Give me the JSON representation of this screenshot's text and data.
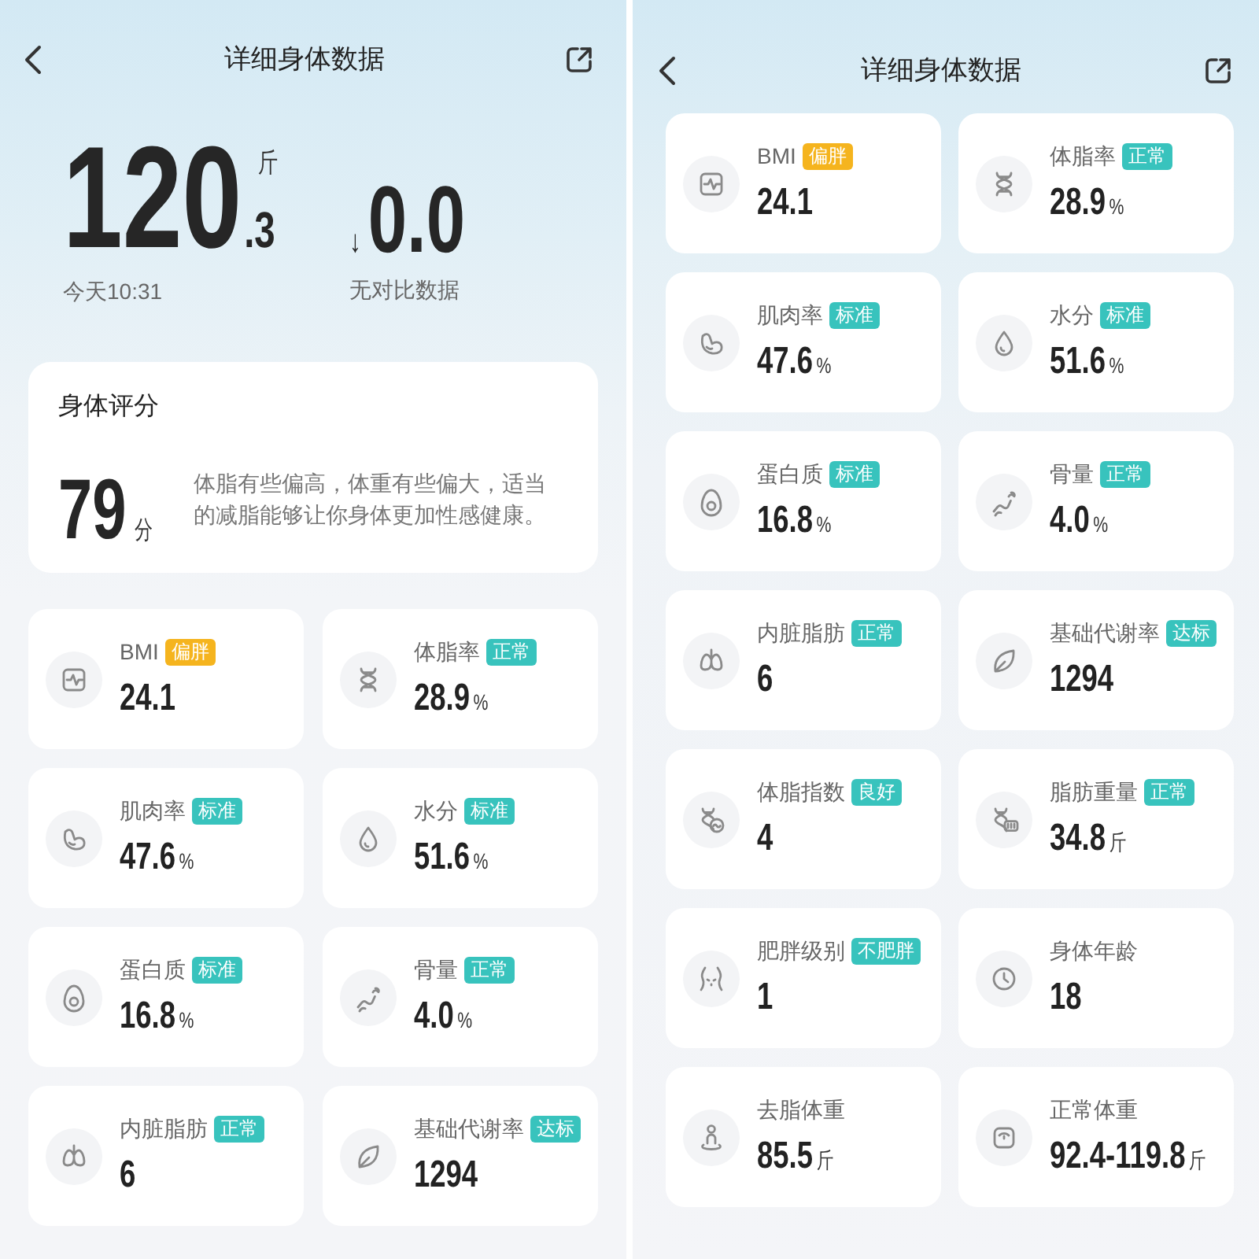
{
  "screens": [
    {
      "header": {
        "title": "详细身体数据"
      },
      "weight": {
        "integer": "120",
        "decimal": ".3",
        "unit": "斤",
        "time": "今天10:31"
      },
      "change": {
        "arrow": "↓",
        "value": "0.0",
        "note": "无对比数据"
      },
      "score_card": {
        "title": "身体评分",
        "score": "79",
        "unit": "分",
        "description": "体脂有些偏高，体重有些偏大，适当的减脂能够让你身体更加性感健康。"
      },
      "metrics": [
        {
          "label": "BMI",
          "badge": {
            "text": "偏胖",
            "color": "#f5b41e"
          },
          "value": "24.1"
        },
        {
          "label": "体脂率",
          "badge": {
            "text": "正常",
            "color": "#38c3bd"
          },
          "value": "28.9",
          "unit": "%"
        },
        {
          "label": "肌肉率",
          "badge": {
            "text": "标准",
            "color": "#38c3bd"
          },
          "value": "47.6",
          "unit": "%"
        },
        {
          "label": "水分",
          "badge": {
            "text": "标准",
            "color": "#38c3bd"
          },
          "value": "51.6",
          "unit": "%"
        },
        {
          "label": "蛋白质",
          "badge": {
            "text": "标准",
            "color": "#38c3bd"
          },
          "value": "16.8",
          "unit": "%"
        },
        {
          "label": "骨量",
          "badge": {
            "text": "正常",
            "color": "#38c3bd"
          },
          "value": "4.0",
          "unit": "%"
        },
        {
          "label": "内脏脂肪",
          "badge": {
            "text": "正常",
            "color": "#38c3bd"
          },
          "value": "6"
        },
        {
          "label": "基础代谢率",
          "badge": {
            "text": "达标",
            "color": "#38c3bd"
          },
          "value": "1294"
        }
      ]
    },
    {
      "header": {
        "title": "详细身体数据"
      },
      "metrics": [
        {
          "label": "BMI",
          "badge": {
            "text": "偏胖",
            "color": "#f5b41e"
          },
          "value": "24.1"
        },
        {
          "label": "体脂率",
          "badge": {
            "text": "正常",
            "color": "#38c3bd"
          },
          "value": "28.9",
          "unit": "%"
        },
        {
          "label": "肌肉率",
          "badge": {
            "text": "标准",
            "color": "#38c3bd"
          },
          "value": "47.6",
          "unit": "%"
        },
        {
          "label": "水分",
          "badge": {
            "text": "标准",
            "color": "#38c3bd"
          },
          "value": "51.6",
          "unit": "%"
        },
        {
          "label": "蛋白质",
          "badge": {
            "text": "标准",
            "color": "#38c3bd"
          },
          "value": "16.8",
          "unit": "%"
        },
        {
          "label": "骨量",
          "badge": {
            "text": "正常",
            "color": "#38c3bd"
          },
          "value": "4.0",
          "unit": "%"
        },
        {
          "label": "内脏脂肪",
          "badge": {
            "text": "正常",
            "color": "#38c3bd"
          },
          "value": "6"
        },
        {
          "label": "基础代谢率",
          "badge": {
            "text": "达标",
            "color": "#38c3bd"
          },
          "value": "1294"
        },
        {
          "label": "体脂指数",
          "badge": {
            "text": "良好",
            "color": "#38c3bd"
          },
          "value": "4"
        },
        {
          "label": "脂肪重量",
          "badge": {
            "text": "正常",
            "color": "#38c3bd"
          },
          "value": "34.8",
          "unit": "斤"
        },
        {
          "label": "肥胖级别",
          "badge": {
            "text": "不肥胖",
            "color": "#38c3bd"
          },
          "value": "1"
        },
        {
          "label": "身体年龄",
          "value": "18"
        },
        {
          "label": "去脂体重",
          "value": "85.5",
          "unit": "斤"
        },
        {
          "label": "正常体重",
          "value": "92.4-119.8",
          "unit": "斤"
        }
      ]
    }
  ]
}
